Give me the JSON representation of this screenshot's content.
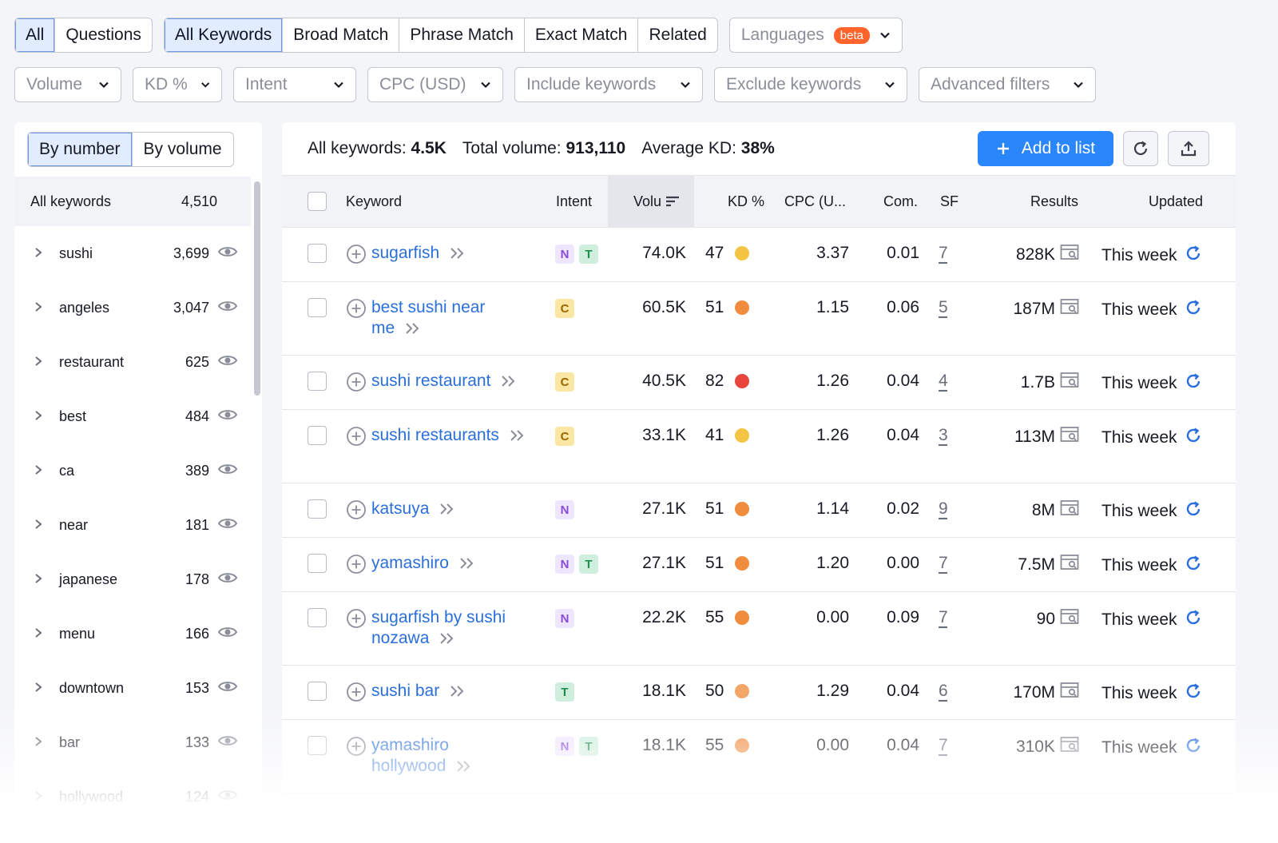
{
  "tabs_type": [
    {
      "label": "All",
      "active": true
    },
    {
      "label": "Questions",
      "active": false
    }
  ],
  "tabs_match": [
    {
      "label": "All Keywords",
      "active": true
    },
    {
      "label": "Broad Match",
      "active": false
    },
    {
      "label": "Phrase Match",
      "active": false
    },
    {
      "label": "Exact Match",
      "active": false
    },
    {
      "label": "Related",
      "active": false
    }
  ],
  "languages": {
    "label": "Languages",
    "badge": "beta"
  },
  "filters": [
    "Volume",
    "KD %",
    "Intent",
    "CPC (USD)",
    "Include keywords",
    "Exclude keywords",
    "Advanced filters"
  ],
  "left_panel": {
    "toggle": [
      {
        "label": "By number",
        "active": true
      },
      {
        "label": "By volume",
        "active": false
      }
    ],
    "all_keywords": {
      "label": "All keywords",
      "count": "4,510"
    },
    "groups": [
      {
        "name": "sushi",
        "count": "3,699"
      },
      {
        "name": "angeles",
        "count": "3,047"
      },
      {
        "name": "restaurant",
        "count": "625"
      },
      {
        "name": "best",
        "count": "484"
      },
      {
        "name": "ca",
        "count": "389"
      },
      {
        "name": "near",
        "count": "181"
      },
      {
        "name": "japanese",
        "count": "178"
      },
      {
        "name": "menu",
        "count": "166"
      },
      {
        "name": "downtown",
        "count": "153"
      },
      {
        "name": "bar",
        "count": "133"
      },
      {
        "name": "hollywood",
        "count": "124"
      }
    ]
  },
  "summary": {
    "all_keywords_label": "All keywords:",
    "all_keywords_value": "4.5K",
    "total_volume_label": "Total volume:",
    "total_volume_value": "913,110",
    "avg_kd_label": "Average KD:",
    "avg_kd_value": "38%"
  },
  "add_to_list": "Add to list",
  "headers": {
    "keyword": "Keyword",
    "intent": "Intent",
    "volume": "Volu",
    "kd": "KD %",
    "cpc": "CPC (U...",
    "com": "Com.",
    "sf": "SF",
    "results": "Results",
    "updated": "Updated"
  },
  "colors": {
    "kd_yellow": "#f4c542",
    "kd_orange": "#f08c3e",
    "kd_red": "#e8453c",
    "kd_light_orange": "#f4a669",
    "accent": "#2a86fb"
  },
  "rows": [
    {
      "kw1": "sugarfish",
      "kw2": "",
      "intent": [
        "N",
        "T"
      ],
      "volume": "74.0K",
      "kd": "47",
      "kd_color": "#f4c542",
      "cpc": "3.37",
      "com": "0.01",
      "sf": "7",
      "results": "828K",
      "updated": "This week"
    },
    {
      "kw1": "best sushi near",
      "kw2": "me",
      "intent": [
        "C"
      ],
      "volume": "60.5K",
      "kd": "51",
      "kd_color": "#f08c3e",
      "cpc": "1.15",
      "com": "0.06",
      "sf": "5",
      "results": "187M",
      "updated": "This week"
    },
    {
      "kw1": "sushi restaurant",
      "kw2": "",
      "intent": [
        "C"
      ],
      "volume": "40.5K",
      "kd": "82",
      "kd_color": "#e8453c",
      "cpc": "1.26",
      "com": "0.04",
      "sf": "4",
      "results": "1.7B",
      "updated": "This week"
    },
    {
      "kw1": "sushi restaurants",
      "kw2": "",
      "intent": [
        "C"
      ],
      "volume": "33.1K",
      "kd": "41",
      "kd_color": "#f4c542",
      "cpc": "1.26",
      "com": "0.04",
      "sf": "3",
      "results": "113M",
      "updated": "This week"
    },
    {
      "kw1": "katsuya",
      "kw2": "",
      "intent": [
        "N"
      ],
      "volume": "27.1K",
      "kd": "51",
      "kd_color": "#f08c3e",
      "cpc": "1.14",
      "com": "0.02",
      "sf": "9",
      "results": "8M",
      "updated": "This week"
    },
    {
      "kw1": "yamashiro",
      "kw2": "",
      "intent": [
        "N",
        "T"
      ],
      "volume": "27.1K",
      "kd": "51",
      "kd_color": "#f08c3e",
      "cpc": "1.20",
      "com": "0.00",
      "sf": "7",
      "results": "7.5M",
      "updated": "This week"
    },
    {
      "kw1": "sugarfish by sushi",
      "kw2": "nozawa",
      "intent": [
        "N"
      ],
      "volume": "22.2K",
      "kd": "55",
      "kd_color": "#f08c3e",
      "cpc": "0.00",
      "com": "0.09",
      "sf": "7",
      "results": "90",
      "updated": "This week"
    },
    {
      "kw1": "sushi bar",
      "kw2": "",
      "intent": [
        "T"
      ],
      "volume": "18.1K",
      "kd": "50",
      "kd_color": "#f4a669",
      "cpc": "1.29",
      "com": "0.04",
      "sf": "6",
      "results": "170M",
      "updated": "This week"
    },
    {
      "kw1": "yamashiro",
      "kw2": "hollywood",
      "intent": [
        "N",
        "T"
      ],
      "volume": "18.1K",
      "kd": "55",
      "kd_color": "#f08c3e",
      "cpc": "0.00",
      "com": "0.04",
      "sf": "7",
      "results": "310K",
      "updated": "This week"
    }
  ]
}
